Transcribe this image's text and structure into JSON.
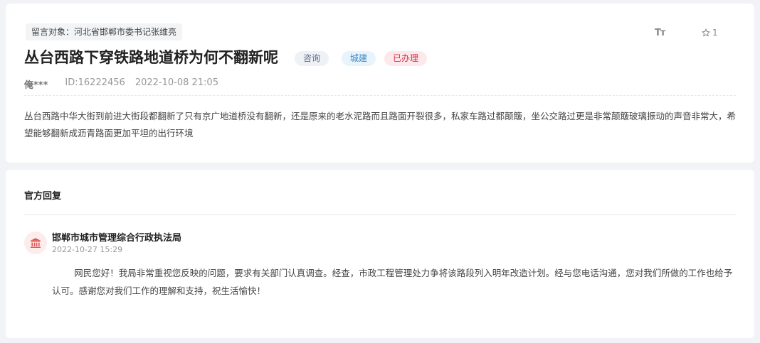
{
  "message": {
    "recipient": "留言对象：河北省邯郸市委书记张维亮",
    "title": "丛台西路下穿铁路地道桥为何不翻新呢",
    "tags": [
      "咨询",
      "城建",
      "已办理"
    ],
    "author": "俺***",
    "id": "ID:16222456",
    "date": "2022-10-08 21:05",
    "font_size_label": "Tт",
    "favorite_count": "1",
    "content": "丛台西路中华大街到前进大街段都翻新了只有京广地道桥没有翻新，还是原来的老水泥路而且路面开裂很多，私家车路过都颠簸，坐公交路过更是非常颠簸玻璃振动的声音非常大，希望能够翻新成沥青路面更加平坦的出行环境"
  },
  "reply": {
    "section_title": "官方回复",
    "department": "邯郸市城市管理综合行政执法局",
    "date": "2022-10-27 15:29",
    "content": "网民您好！我局非常重视您反映的问题，要求有关部门认真调查。经查，市政工程管理处力争将该路段列入明年改造计划。经与您电话沟通，您对我们所做的工作也给予认可。感谢您对我们工作的理解和支持，祝生活愉快！"
  },
  "icons": {
    "favorite": "star-outline-icon",
    "department": "government-building-icon"
  },
  "colors": {
    "tag_consult": "#5b6b82",
    "tag_urban": "#3a86c2",
    "tag_done": "#d6314a",
    "dept_icon": "#e05555"
  }
}
